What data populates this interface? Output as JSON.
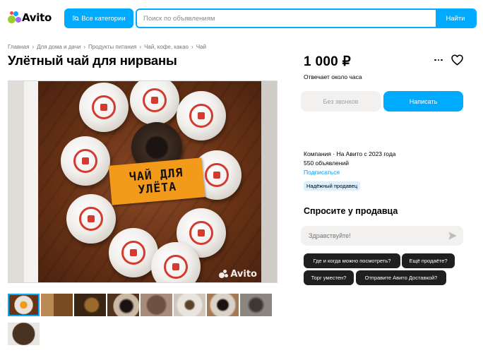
{
  "header": {
    "logo_text": "Avito",
    "categories_button": "Все категории",
    "search_placeholder": "Поиск по объявлениям",
    "search_button": "Найти"
  },
  "breadcrumb": [
    "Главная",
    "Для дома и дачи",
    "Продукты питания",
    "Чай, кофе, какао",
    "Чай"
  ],
  "listing": {
    "title": "Улётный чай для нирваны",
    "image_banner_line1": "ЧАЙ ДЛЯ",
    "image_banner_line2": "УЛЁТА",
    "image_watermark": "Avito",
    "thumbnail_count": 9
  },
  "sidebar": {
    "price": "1 000 ₽",
    "response_time": "Отвечает около часа",
    "no_calls_button": "Без звонков",
    "write_button": "Написать",
    "seller_line": "Компания · На Авито с 2023 года",
    "listings_count": "550 объявлений",
    "subscribe_link": "Подписаться",
    "badge": "Надёжный продавец",
    "ask_title": "Спросите у продавца",
    "ask_placeholder": "Здравствуйте!",
    "quick_questions": [
      "Где и когда можно посмотреть?",
      "Ещё продаёте?",
      "Торг уместен?",
      "Отправите Авито Доставкой?"
    ]
  },
  "colors": {
    "accent": "#00aaff",
    "link": "#0099f7",
    "chip_bg": "#1f1f1f",
    "banner": "#f39a1a",
    "logo_green": "#97cf26",
    "logo_blue": "#0aa7ff",
    "logo_red": "#ff4053",
    "logo_purple": "#a169f7"
  },
  "icons": [
    "avito-logo-icon",
    "search-icon",
    "more-icon",
    "heart-icon",
    "send-icon"
  ]
}
